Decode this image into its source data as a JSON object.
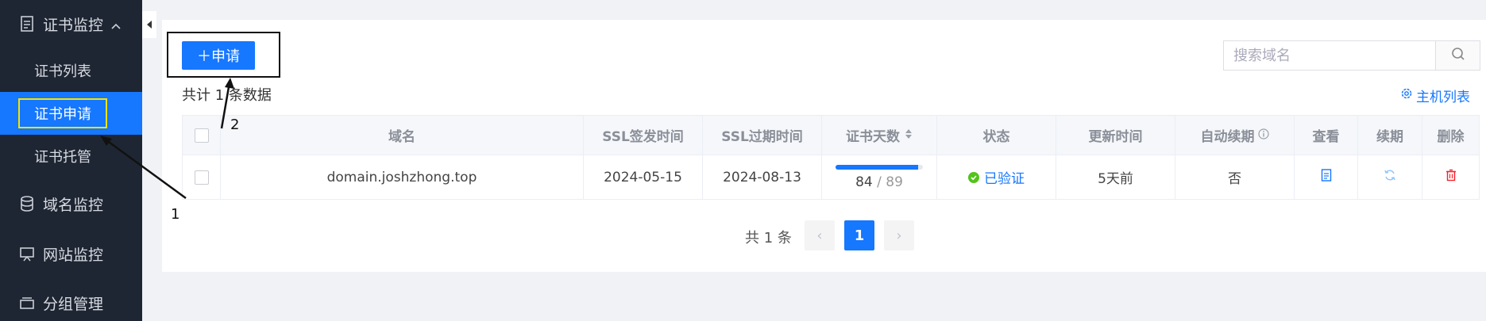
{
  "sidebar": {
    "cert_monitor": "证书监控",
    "cert_list": "证书列表",
    "cert_apply": "证书申请",
    "cert_hosting": "证书托管",
    "domain_monitor": "域名监控",
    "site_monitor": "网站监控",
    "group_manage": "分组管理"
  },
  "toolbar": {
    "apply_label": "＋申请",
    "total_text": "共计 1 条数据",
    "search_placeholder": "搜索域名",
    "host_list_label": "主机列表"
  },
  "table": {
    "headers": [
      "域名",
      "SSL签发时间",
      "SSL过期时间",
      "证书天数",
      "状态",
      "更新时间",
      "自动续期",
      "查看",
      "续期",
      "删除"
    ],
    "rows": [
      {
        "domain": "domain.joshzhong.top",
        "issued": "2024-05-15",
        "expires": "2024-08-13",
        "days_left": "84",
        "days_sep": " / ",
        "days_total": "89",
        "days_fraction": 0.944,
        "status": "已验证",
        "updated": "5天前",
        "auto_renew": "否"
      }
    ]
  },
  "pagination": {
    "total": "共 1 条",
    "current": "1",
    "prev": "‹",
    "next": "›"
  },
  "annotations": {
    "one": "1",
    "two": "2"
  },
  "colors": {
    "primary": "#1677ff",
    "sidebar_bg": "#1f2633",
    "success": "#52c41a",
    "danger": "#f5222d",
    "highlight": "#f5e400"
  }
}
